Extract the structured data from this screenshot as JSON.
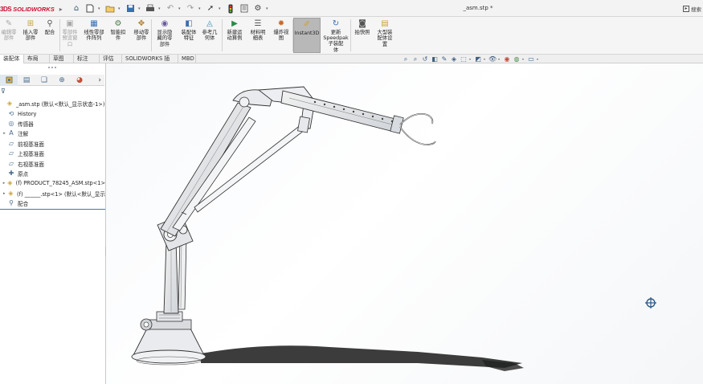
{
  "app": {
    "logo_ds": "3DS",
    "logo_name": "SOLIDWORKS",
    "document_title": "_asm.stp *",
    "search_label": "搜索"
  },
  "ribbon": {
    "buttons": [
      {
        "id": "edit-component",
        "label": "编辑零\n部件",
        "icon": "edit-component-icon",
        "disabled": true
      },
      {
        "id": "insert-component",
        "label": "插入零\n部件",
        "icon": "insert-component-icon",
        "disabled": false
      },
      {
        "id": "mate",
        "label": "配合",
        "icon": "mate-icon",
        "disabled": false
      },
      {
        "id": "component-preview",
        "label": "零部件\n预览窗\n口",
        "icon": "preview-window-icon",
        "disabled": true
      },
      {
        "id": "linear-pattern",
        "label": "线性零部\n件阵列",
        "icon": "linear-pattern-icon",
        "disabled": false
      },
      {
        "id": "smart-fasteners",
        "label": "智能扣\n件",
        "icon": "smart-fasteners-icon",
        "disabled": false
      },
      {
        "id": "move-component",
        "label": "移动零\n部件",
        "icon": "move-component-icon",
        "disabled": false
      },
      {
        "id": "show-hidden",
        "label": "显示隐\n藏的零\n部件",
        "icon": "show-hidden-icon",
        "disabled": false
      },
      {
        "id": "assembly-features",
        "label": "装配体\n特征",
        "icon": "assembly-features-icon",
        "disabled": false
      },
      {
        "id": "reference-geometry",
        "label": "参考几\n何体",
        "icon": "reference-geometry-icon",
        "disabled": false
      },
      {
        "id": "new-motion-study",
        "label": "新建运\n动算例",
        "icon": "motion-study-icon",
        "disabled": false
      },
      {
        "id": "bill-of-materials",
        "label": "材料明\n细表",
        "icon": "bom-icon",
        "disabled": false
      },
      {
        "id": "exploded-view",
        "label": "爆炸视\n图",
        "icon": "exploded-view-icon",
        "disabled": false
      },
      {
        "id": "instant3d",
        "label": "Instant3D",
        "icon": "instant3d-icon",
        "disabled": false,
        "active": true
      },
      {
        "id": "update-speedpak",
        "label": "更新\nSpeedpak\n子装配\n体",
        "icon": "speedpak-icon",
        "disabled": false
      },
      {
        "id": "take-snapshot",
        "label": "拍快照",
        "icon": "camera-icon",
        "disabled": false
      },
      {
        "id": "large-assembly-settings",
        "label": "大型装\n配体设\n置",
        "icon": "large-assembly-icon",
        "disabled": false
      }
    ]
  },
  "tabs": [
    {
      "label": "装配体",
      "selected": true
    },
    {
      "label": "布局",
      "selected": false
    },
    {
      "label": "草图",
      "selected": false
    },
    {
      "label": "标注",
      "selected": false
    },
    {
      "label": "评估",
      "selected": false
    },
    {
      "label": "SOLIDWORKS 插件",
      "selected": false
    },
    {
      "label": "MBD",
      "selected": false
    }
  ],
  "tree": [
    {
      "label": "_asm.stp  (默认<默认_显示状态-1>)",
      "icon": "assembly-icon",
      "expander": ""
    },
    {
      "label": "History",
      "icon": "history-icon",
      "expander": ""
    },
    {
      "label": "传感器",
      "icon": "sensor-icon",
      "expander": ""
    },
    {
      "label": "注解",
      "icon": "annotation-icon",
      "expander": "▸"
    },
    {
      "label": "前视基准面",
      "icon": "plane-icon",
      "expander": ""
    },
    {
      "label": "上视基准面",
      "icon": "plane-icon",
      "expander": ""
    },
    {
      "label": "右视基准面",
      "icon": "plane-icon",
      "expander": ""
    },
    {
      "label": "原点",
      "icon": "origin-icon",
      "expander": ""
    },
    {
      "label": "(f) PRODUCT_78245_ASM.stp<1>",
      "icon": "subassembly-icon",
      "expander": "▸"
    },
    {
      "label": "(f) ______.stp<1> (默认<默认_显示",
      "icon": "subassembly-icon",
      "expander": "▸"
    },
    {
      "label": "配合",
      "icon": "mates-folder-icon",
      "expander": ""
    }
  ],
  "colors": {
    "brand_red": "#c8102e",
    "tree_selection_line": "#3a78c3",
    "active_button": "#b8b8b8"
  }
}
